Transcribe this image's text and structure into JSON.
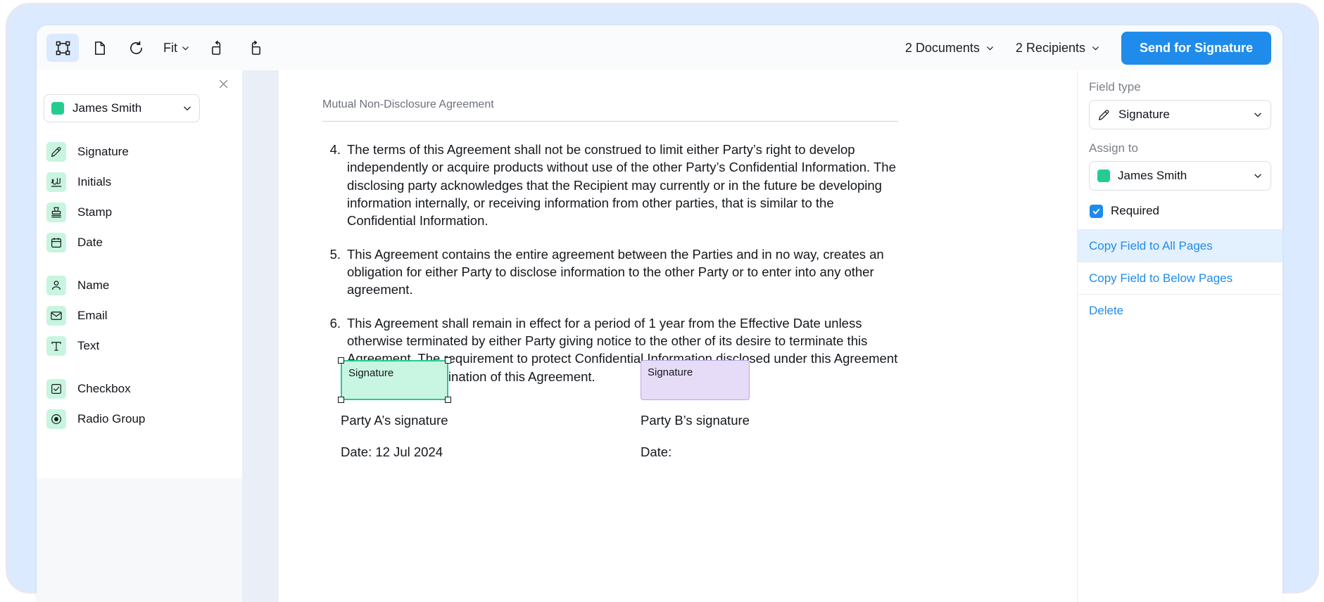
{
  "toolbar": {
    "tools": [
      {
        "name": "select-field-tool",
        "icon": "bounding-box-icon",
        "active": true
      },
      {
        "name": "page-tool",
        "icon": "document-page-icon",
        "active": false
      },
      {
        "name": "reset-rotation-tool",
        "icon": "refresh-icon",
        "active": false
      }
    ],
    "fit_label": "Fit",
    "rotate_left_icon": "rotate-left-icon",
    "rotate_right_icon": "rotate-right-icon",
    "documents_dropdown": "2 Documents",
    "recipients_dropdown": "2 Recipients",
    "send_button": "Send for Signature",
    "send_button_color": "#1f8ceb"
  },
  "left_panel": {
    "close_icon": "close-icon",
    "recipient": {
      "name": "James Smith",
      "color": "#24cc90"
    },
    "fields": [
      {
        "label": "Signature",
        "icon": "signature-pen-icon",
        "gap": false
      },
      {
        "label": "Initials",
        "icon": "initials-icon",
        "gap": false
      },
      {
        "label": "Stamp",
        "icon": "stamp-icon",
        "gap": false
      },
      {
        "label": "Date",
        "icon": "calendar-icon",
        "gap": false
      },
      {
        "label": "Name",
        "icon": "person-icon",
        "gap": true
      },
      {
        "label": "Email",
        "icon": "envelope-icon",
        "gap": false
      },
      {
        "label": "Text",
        "icon": "text-t-icon",
        "gap": false
      },
      {
        "label": "Checkbox",
        "icon": "checkbox-icon",
        "gap": true
      },
      {
        "label": "Radio Group",
        "icon": "radio-button-icon",
        "gap": false
      }
    ],
    "field_icon_bg": "#c8f5e0"
  },
  "document": {
    "title": "Mutual Non-Disclosure Agreement",
    "clauses": [
      {
        "num": "4.",
        "text": "The terms of this Agreement shall not be construed to limit either Party’s right to develop independently or acquire products without use of the other Party’s Confidential Information. The disclosing party acknowledges that the Recipient may currently or in the future be developing information internally, or receiving information from other parties, that is similar to the Confidential Information."
      },
      {
        "num": "5.",
        "text": "This Agreement contains the entire agreement between the Parties and in no way, creates an obligation for either Party to disclose information to the other Party or to enter into any other agreement."
      },
      {
        "num": "6.",
        "text": "This Agreement shall remain in effect for a period of 1 year from the Effective Date unless otherwise terminated by either Party giving notice to the other of its desire to terminate this Agreement. The requirement to protect Confidential Information disclosed under this Agreement shall survive termination of this Agreement."
      }
    ],
    "signature_blocks": [
      {
        "field_label": "Signature",
        "caption": "Party A’s signature",
        "date": "Date: 12 Jul 2024",
        "state": "selected",
        "border_color": "#24cc90",
        "fill_color": "#c9f6e3"
      },
      {
        "field_label": "Signature",
        "caption": "Party B’s signature",
        "date": "Date:",
        "state": "unselected",
        "border_color": "#bda5e6",
        "fill_color": "#e6dcf7"
      }
    ]
  },
  "right_panel": {
    "field_type_label": "Field type",
    "field_type_value": "Signature",
    "field_type_icon": "signature-pen-icon",
    "assign_to_label": "Assign to",
    "assign_to_value": "James Smith",
    "assign_to_color": "#24cc90",
    "required_label": "Required",
    "required_checked": true,
    "required_color": "#1f8ceb",
    "actions": [
      {
        "label": "Copy Field to All Pages",
        "highlighted": true
      },
      {
        "label": "Copy Field to Below Pages",
        "highlighted": false
      },
      {
        "label": "Delete",
        "highlighted": false
      }
    ],
    "link_color": "#1f8ceb"
  }
}
